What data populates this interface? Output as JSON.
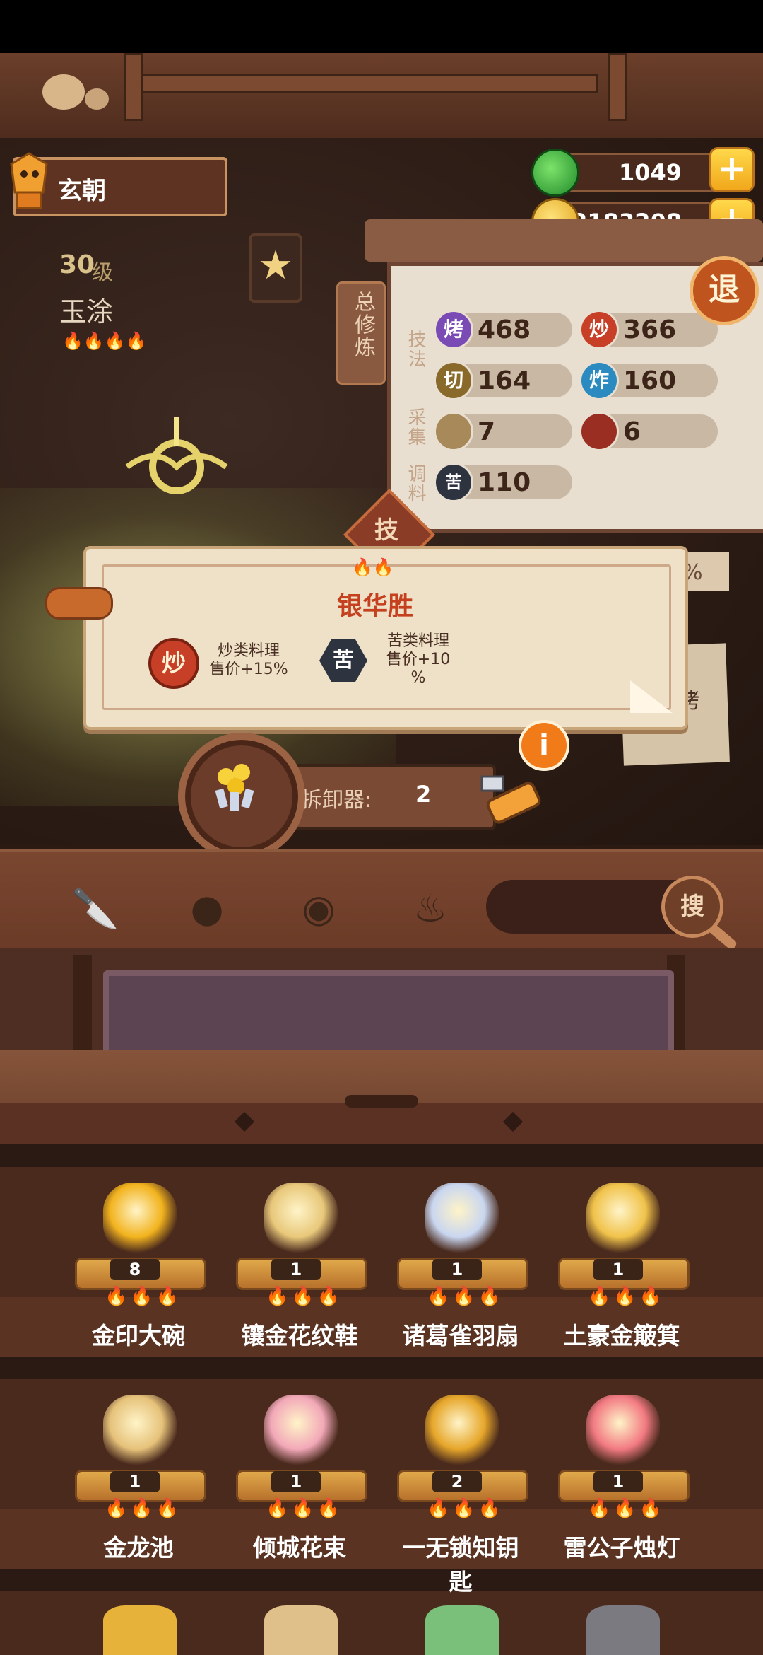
{
  "player": {
    "name": "玄朝"
  },
  "currency": {
    "jade": {
      "value": "1049",
      "icon": "jade-coin-icon"
    },
    "gold": {
      "value": "62183208",
      "icon": "gold-coin-icon"
    }
  },
  "chef": {
    "level_number": "30",
    "level_unit": "级",
    "name": "玉涂",
    "stars": "🔥🔥🔥🔥"
  },
  "stats_panel": {
    "tab_label": "总修炼",
    "categories": {
      "technique": "技法",
      "gather": "采集",
      "seasoning": "调料"
    },
    "technique": [
      {
        "icon_label": "烤",
        "value": "468",
        "color": "#7b4bb5"
      },
      {
        "icon_label": "炒",
        "value": "366",
        "color": "#c63f26"
      },
      {
        "icon_label": "切",
        "value": "164",
        "color": "#8a6a2a"
      },
      {
        "icon_label": "炸",
        "value": "160",
        "color": "#2b8bc0"
      }
    ],
    "gather": [
      {
        "icon": "rice-bowl-icon",
        "value": "7"
      },
      {
        "icon": "meat-icon",
        "value": "6"
      }
    ],
    "seasoning": [
      {
        "icon_label": "苦",
        "value": "110"
      }
    ],
    "exit_label": "退"
  },
  "skill_tab_label": "技",
  "popup": {
    "flames": "🔥🔥",
    "title": "银华胜",
    "bonuses": [
      {
        "icon_label": "炒",
        "line1": "炒类料理",
        "line2": "售价+15%"
      },
      {
        "icon_label": "苦",
        "line1": "苦类料理",
        "line2": "售价+10",
        "line3": "%"
      }
    ]
  },
  "right_panel": {
    "ribbon_text": "%",
    "paper_text": "与烤"
  },
  "remover": {
    "label": "拆卸器:",
    "value": "2",
    "info_label": "i"
  },
  "filters": [
    "knife-icon",
    "dumpling-icon",
    "pan-icon",
    "flame-icon"
  ],
  "search_label": "搜",
  "items": [
    {
      "name": "金印大碗",
      "count": "8",
      "flames": "🔥🔥🔥",
      "icon": "golden-bowl-icon"
    },
    {
      "name": "镶金花纹鞋",
      "count": "1",
      "flames": "🔥🔥🔥",
      "icon": "gold-shoes-icon"
    },
    {
      "name": "诸葛雀羽扇",
      "count": "1",
      "flames": "🔥🔥🔥",
      "icon": "feather-fan-icon"
    },
    {
      "name": "土豪金簸箕",
      "count": "1",
      "flames": "🔥🔥🔥",
      "icon": "gold-dustpan-icon"
    },
    {
      "name": "金龙池",
      "count": "1",
      "flames": "🔥🔥🔥",
      "icon": "dragon-pond-icon"
    },
    {
      "name": "倾城花束",
      "count": "1",
      "flames": "🔥🔥🔥",
      "icon": "bouquet-icon"
    },
    {
      "name": "一无锁知钥匙",
      "count": "2",
      "flames": "🔥🔥🔥",
      "icon": "golden-key-icon"
    },
    {
      "name": "雷公子烛灯",
      "count": "1",
      "flames": "🔥🔥🔥",
      "icon": "candle-lamp-icon"
    }
  ]
}
